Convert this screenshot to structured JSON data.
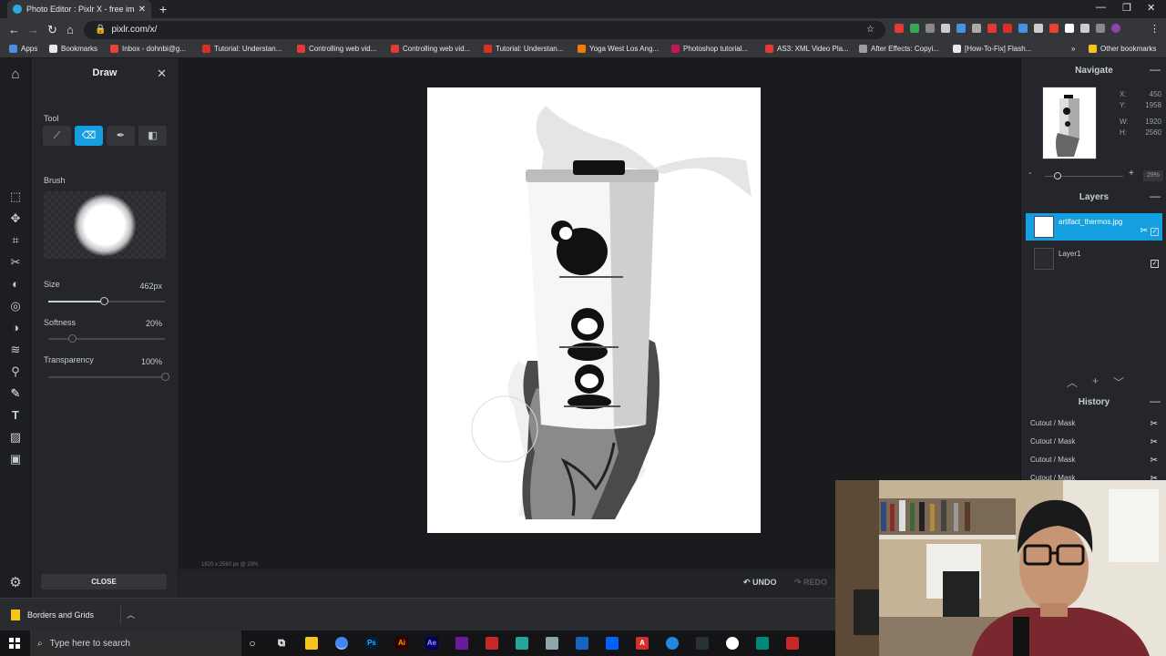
{
  "browser": {
    "tab_title": "Photo Editor : Pixlr X - free image...",
    "url": "pixlr.com/x/",
    "bookmarks": [
      {
        "label": "Apps",
        "color": "#4a90e2"
      },
      {
        "label": "Bookmarks",
        "color": "#e8eaed"
      },
      {
        "label": "Inbox - dohnbi@g...",
        "color": "#ea4335"
      },
      {
        "label": "Tutorial: Understan...",
        "color": "#d93025"
      },
      {
        "label": "Controlling web vid...",
        "color": "#e53935"
      },
      {
        "label": "Controlling web vid...",
        "color": "#e53935"
      },
      {
        "label": "Tutorial: Understan...",
        "color": "#d93025"
      },
      {
        "label": "Yoga West Los Ang...",
        "color": "#f57c00"
      },
      {
        "label": "Photoshop tutorial...",
        "color": "#c2185b"
      },
      {
        "label": "AS3: XML Video Pla...",
        "color": "#e53935"
      },
      {
        "label": "After Effects: Copyi...",
        "color": "#9e9e9e"
      },
      {
        "label": "[How-To-Fix] Flash...",
        "color": "#e8eaed"
      }
    ],
    "other_bookmarks": "Other bookmarks"
  },
  "draw_panel": {
    "title": "Draw",
    "tool_label": "Tool",
    "brush_label": "Brush",
    "size_label": "Size",
    "size_value": "462px",
    "size_level": 0.48,
    "softness_label": "Softness",
    "softness_value": "20%",
    "softness_level": 0.2,
    "transparency_label": "Transparency",
    "transparency_value": "100%",
    "transparency_level": 1.0,
    "close_label": "CLOSE"
  },
  "canvas": {
    "status_text": "1920 x 2560 px @ 29%",
    "undo_label": "UNDO",
    "redo_label": "REDO"
  },
  "navigate": {
    "title": "Navigate",
    "x_label": "X:",
    "x_value": "450",
    "y_label": "Y:",
    "y_value": "1958",
    "w_label": "W:",
    "w_value": "1920",
    "h_label": "H:",
    "h_value": "2560",
    "zoom_minus": "-",
    "zoom_plus": "+",
    "zoom_value": "29%"
  },
  "layers": {
    "title": "Layers",
    "items": [
      {
        "name": "artifact_thermos.jpg",
        "selected": true
      },
      {
        "name": "Layer1",
        "selected": false
      }
    ]
  },
  "history": {
    "title": "History",
    "items": [
      "Cutout / Mask",
      "Cutout / Mask",
      "Cutout / Mask",
      "Cutout / Mask"
    ]
  },
  "download": {
    "filename": "Borders and Grids"
  },
  "taskbar": {
    "search_placeholder": "Type here to search"
  },
  "colors": {
    "accent": "#14a0e0",
    "panel": "#25262b",
    "canvas_bg": "#1a1b1f"
  }
}
